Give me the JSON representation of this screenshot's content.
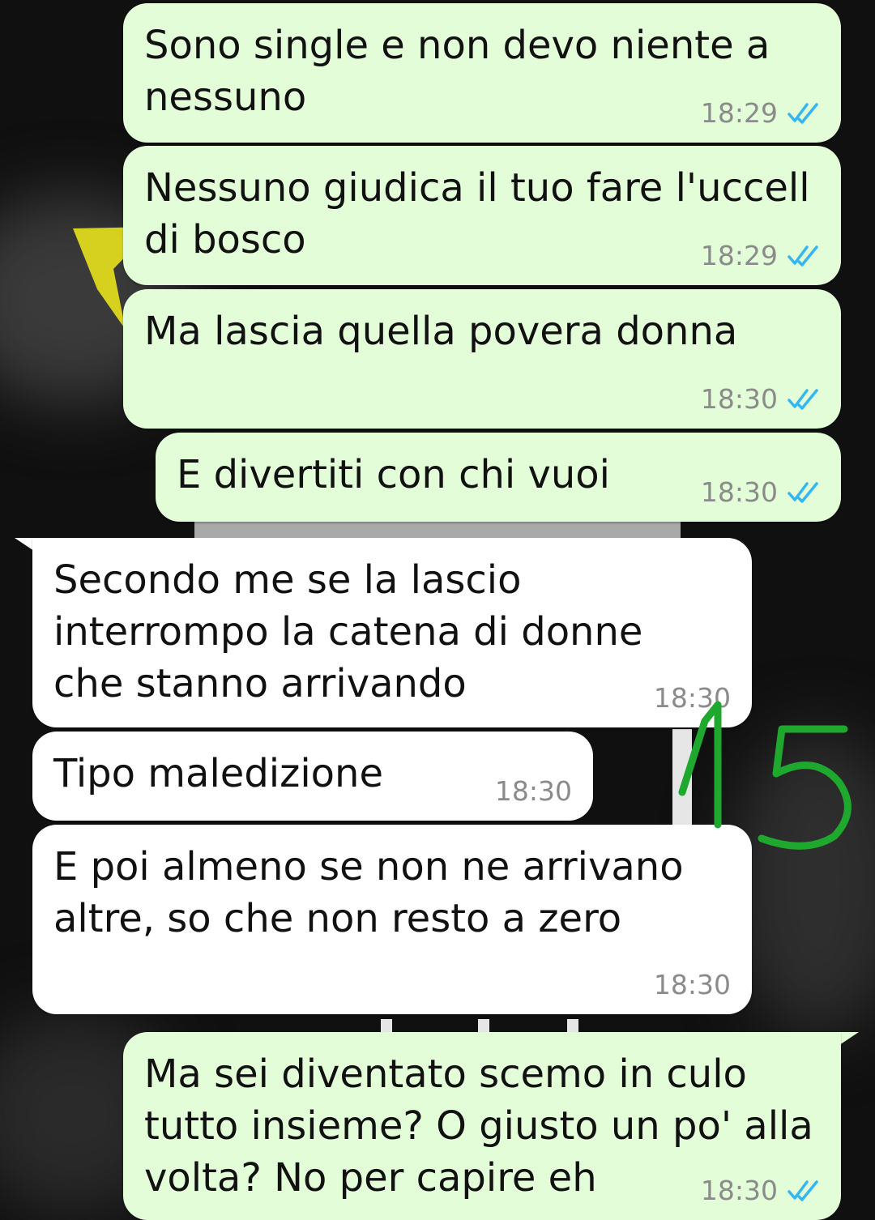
{
  "colors": {
    "outgoing_bubble": "#e3fdd8",
    "incoming_bubble": "#ffffff",
    "read_ticks": "#34b7f1",
    "time_text": "#8b8b8b",
    "annotation": "#1fa82e"
  },
  "messages": [
    {
      "id": "m1",
      "direction": "out",
      "text": "Sono single e non devo niente a\nnessuno",
      "time": "18:29",
      "status": "read"
    },
    {
      "id": "m2",
      "direction": "out",
      "text": "Nessuno giudica il tuo fare l'uccell\ndi bosco",
      "time": "18:29",
      "status": "read"
    },
    {
      "id": "m3",
      "direction": "out",
      "text": "Ma lascia quella povera donna",
      "time": "18:30",
      "status": "read"
    },
    {
      "id": "m4",
      "direction": "out",
      "text": "E divertiti con chi vuoi",
      "time": "18:30",
      "status": "read"
    },
    {
      "id": "m5",
      "direction": "in",
      "text": "Secondo me se la lascio\ninterrompo la catena di donne\nche stanno arrivando",
      "time": "18:30"
    },
    {
      "id": "m6",
      "direction": "in",
      "text": "Tipo maledizione",
      "time": "18:30"
    },
    {
      "id": "m7",
      "direction": "in",
      "text": "E poi almeno se non ne arrivano\naltre, so che non resto a zero",
      "time": "18:30"
    },
    {
      "id": "m8",
      "direction": "out",
      "text": "Ma sei diventato scemo in culo\ntutto insieme? O giusto un po' alla\nvolta? No per capire eh",
      "time": "18:30",
      "status": "read"
    }
  ],
  "annotation": {
    "text": "15",
    "icon": "handwritten-number"
  }
}
